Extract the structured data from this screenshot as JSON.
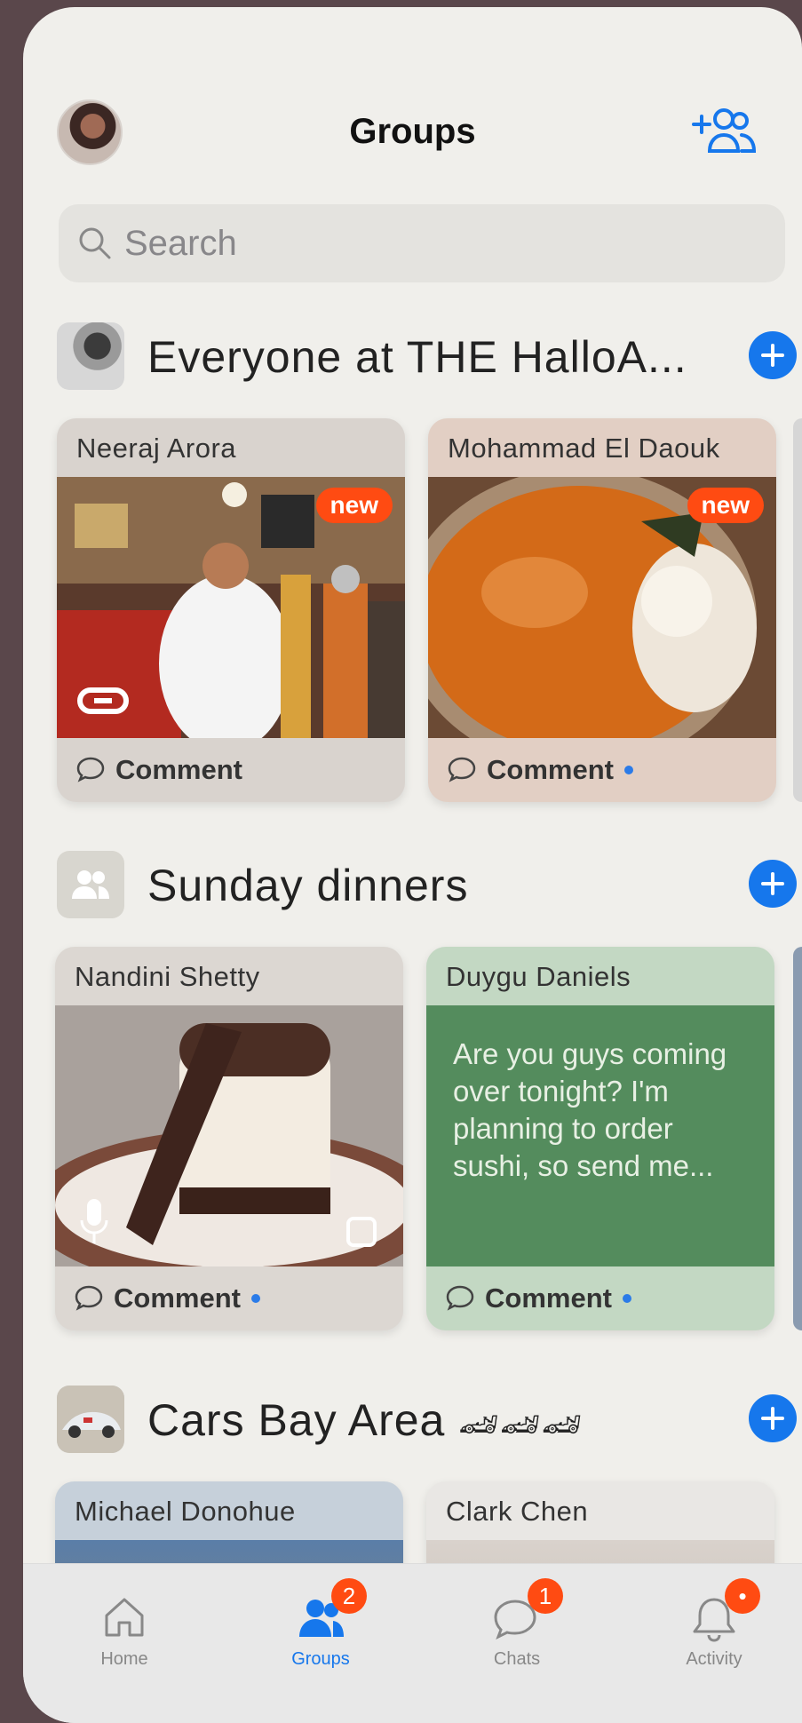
{
  "header": {
    "title": "Groups",
    "search_placeholder": "Search"
  },
  "groups": [
    {
      "title": "Everyone at THE HalloA...",
      "cards": [
        {
          "name": "Neeraj Arora",
          "badge": "new",
          "comment": "Comment",
          "unread": false
        },
        {
          "name": "Mohammad El Daouk",
          "badge": "new",
          "comment": "Comment",
          "unread": true
        }
      ]
    },
    {
      "title": "Sunday dinners",
      "cards": [
        {
          "name": "Nandini Shetty",
          "comment": "Comment",
          "unread": true
        },
        {
          "name": "Duygu Daniels",
          "text": "Are you guys coming over tonight? I'm planning to order sushi, so send me...",
          "comment": "Comment",
          "unread": true
        }
      ]
    },
    {
      "title": "Cars Bay Area",
      "title_emoji": "🏎🏎🏎",
      "cards": [
        {
          "name": "Michael Donohue"
        },
        {
          "name": "Clark Chen"
        }
      ]
    }
  ],
  "tabbar": {
    "home": "Home",
    "groups": "Groups",
    "groups_badge": "2",
    "chats": "Chats",
    "chats_badge": "1",
    "activity": "Activity",
    "activity_badge": "•"
  },
  "colors": {
    "accent": "#1677ec",
    "badge": "#ff4b12",
    "text_card": "#548c5d"
  }
}
